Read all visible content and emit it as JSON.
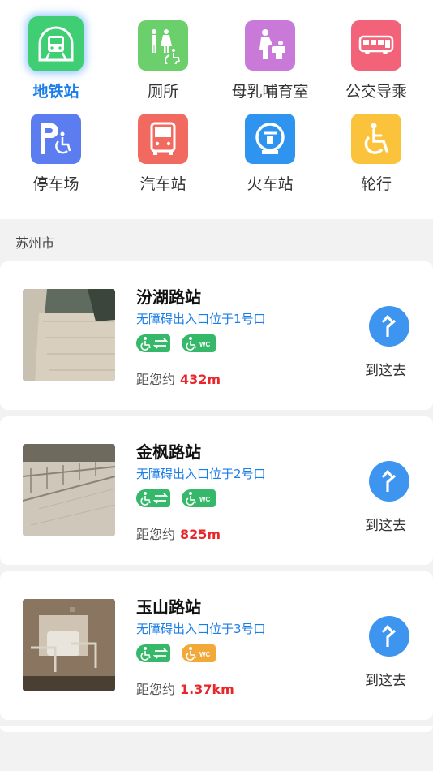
{
  "categories": [
    {
      "label": "地铁站",
      "icon": "subway-icon",
      "color": "#3fce73",
      "active": true
    },
    {
      "label": "厕所",
      "icon": "toilet-icon",
      "color": "#6bd06b"
    },
    {
      "label": "母乳哺育室",
      "icon": "nursing-room-icon",
      "color": "#c97ad8"
    },
    {
      "label": "公交导乘",
      "icon": "bus-guide-icon",
      "color": "#f2637a"
    },
    {
      "label": "停车场",
      "icon": "parking-icon",
      "color": "#5b7df0"
    },
    {
      "label": "汽车站",
      "icon": "bus-station-icon",
      "color": "#f26a5f"
    },
    {
      "label": "火车站",
      "icon": "train-station-icon",
      "color": "#2f94f0"
    },
    {
      "label": "轮行",
      "icon": "wheelchair-icon",
      "color": "#fbc23c"
    }
  ],
  "city": "苏州市",
  "stations": [
    {
      "name": "汾湖路站",
      "entrance": "无障碍出入口位于1号口",
      "distance_label": "距您约",
      "distance": "432m",
      "wc_color": "green",
      "go_label": "到这去"
    },
    {
      "name": "金枫路站",
      "entrance": "无障碍出入口位于2号口",
      "distance_label": "距您约",
      "distance": "825m",
      "wc_color": "green",
      "go_label": "到这去"
    },
    {
      "name": "玉山路站",
      "entrance": "无障碍出入口位于3号口",
      "distance_label": "距您约",
      "distance": "1.37km",
      "wc_color": "orange",
      "go_label": "到这去"
    }
  ]
}
